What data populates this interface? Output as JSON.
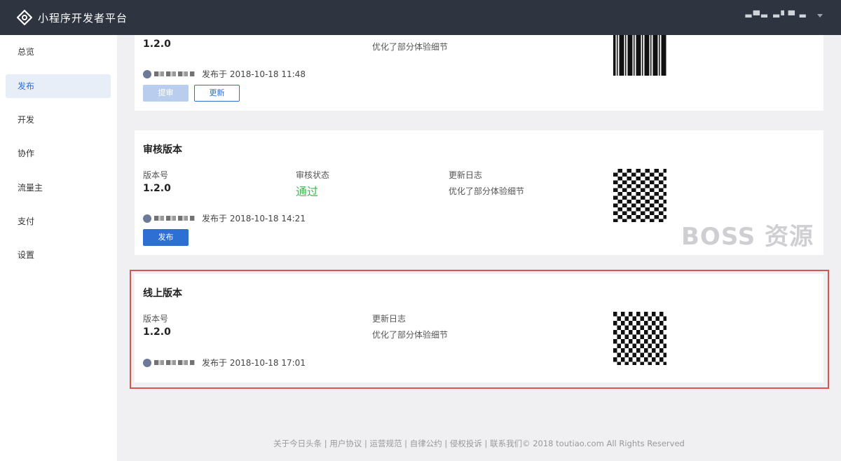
{
  "header": {
    "title": "小程序开发者平台",
    "user_name": "▬▀▬ ▬▘▀ ▬"
  },
  "sidebar": {
    "items": [
      {
        "label": "总览"
      },
      {
        "label": "发布"
      },
      {
        "label": "开发"
      },
      {
        "label": "协作"
      },
      {
        "label": "流量主"
      },
      {
        "label": "支付"
      },
      {
        "label": "设置"
      }
    ]
  },
  "dev_card": {
    "version": "1.2.0",
    "changelog": "优化了部分体验细节",
    "published": "发布于 2018-10-18 11:48",
    "submit_label": "提审",
    "update_label": "更新"
  },
  "review_card": {
    "title": "审核版本",
    "version_label": "版本号",
    "version": "1.2.0",
    "status_label": "审核状态",
    "status": "通过",
    "changelog_label": "更新日志",
    "changelog": "优化了部分体验细节",
    "published": "发布于 2018-10-18 14:21",
    "publish_label": "发布"
  },
  "online_card": {
    "title": "线上版本",
    "version_label": "版本号",
    "version": "1.2.0",
    "changelog_label": "更新日志",
    "changelog": "优化了部分体验细节",
    "published": "发布于 2018-10-18 17:01"
  },
  "watermark": "BOSS 资源",
  "footer": "关于今日头条 | 用户协议 | 运营规范 | 自律公约 | 侵权投诉 | 联系我们© 2018 toutiao.com All Rights Reserved",
  "colors": {
    "header_bg": "#2e3440",
    "accent": "#2d6fd3",
    "success": "#3dba4e",
    "highlight_border": "#d9534f"
  }
}
